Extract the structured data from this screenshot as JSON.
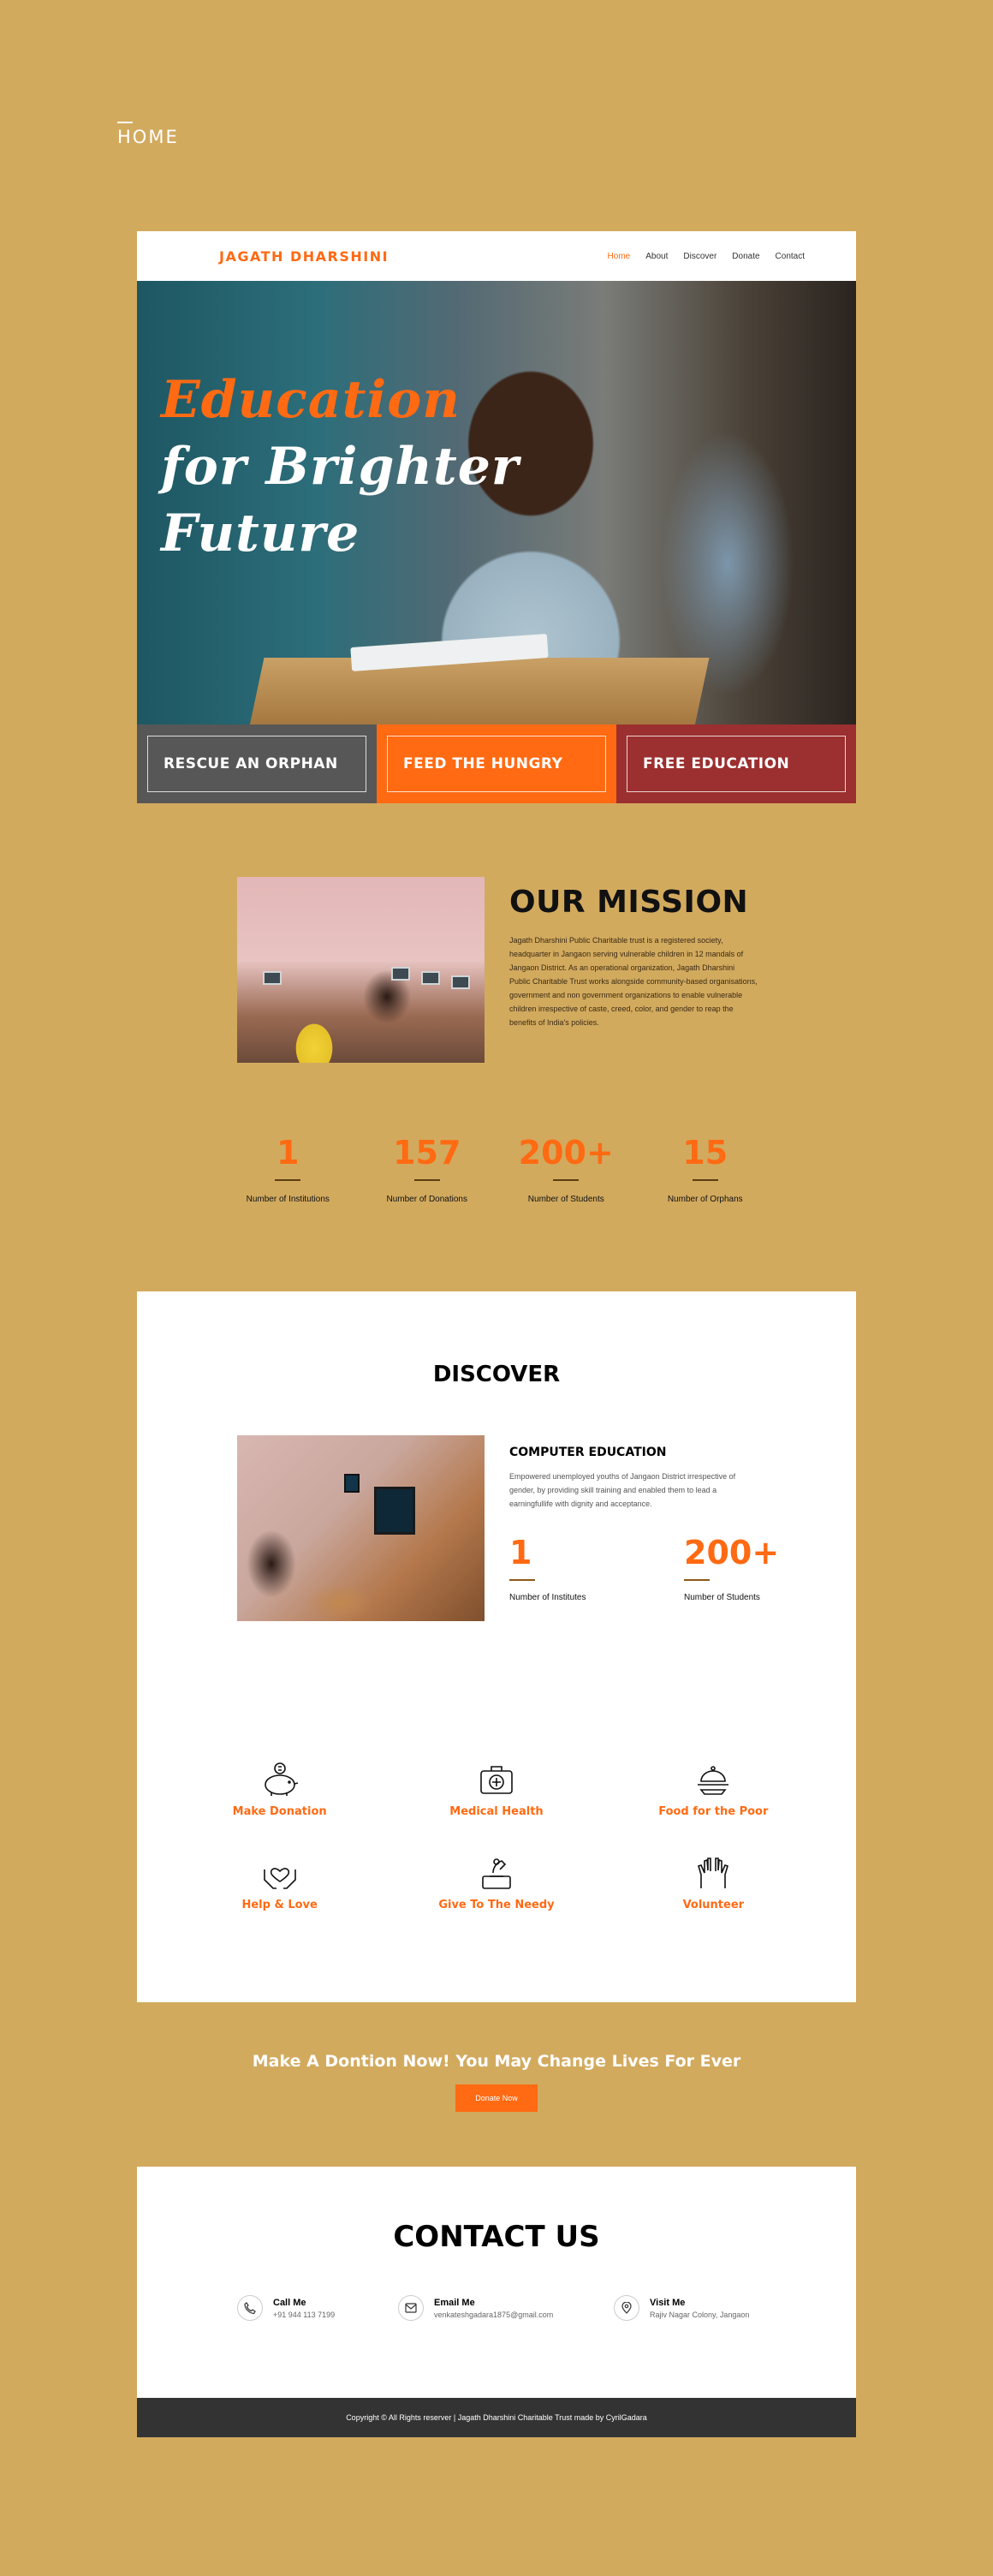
{
  "page_label": "HOME",
  "nav": {
    "logo": "JAGATH DHARSHINI",
    "items": [
      {
        "label": "Home",
        "active": true
      },
      {
        "label": "About",
        "active": false
      },
      {
        "label": "Discover",
        "active": false
      },
      {
        "label": "Donate",
        "active": false
      },
      {
        "label": "Contact",
        "active": false
      }
    ]
  },
  "hero": {
    "line1": "Education",
    "line2": "for Brighter",
    "line3": "Future"
  },
  "tiles": [
    {
      "label": "RESCUE AN ORPHAN"
    },
    {
      "label": "FEED THE HUNGRY"
    },
    {
      "label": "FREE EDUCATION"
    }
  ],
  "mission": {
    "title": "OUR MISSION",
    "text": "Jagath Dharshini Public Charitable trust is a registered society, headquarter in Jangaon serving vulnerable children in 12 mandals of Jangaon District. As an operational organization, Jagath Dharshini Public Charitable Trust works alongside community-based organisations, government and non government organizations to enable vulnerable children irrespective of caste, creed, color, and gender to reap the benefits of India's policies.",
    "stats": [
      {
        "value": "1",
        "label": "Number of Institutions"
      },
      {
        "value": "157",
        "label": "Number of Donations"
      },
      {
        "value": "200+",
        "label": "Number of Students"
      },
      {
        "value": "15",
        "label": "Number of Orphans"
      }
    ]
  },
  "discover": {
    "title": "DISCOVER",
    "subtitle": "COMPUTER EDUCATION",
    "text": "Empowered unemployed youths of Jangaon District irrespective of gender, by providing skill training and enabled them to lead a earningfullife with dignity and acceptance.",
    "stats": [
      {
        "value": "1",
        "label": "Number of Institutes"
      },
      {
        "value": "200+",
        "label": "Number of Students"
      }
    ],
    "features": [
      {
        "label": "Make Donation",
        "icon": "piggy-bank-icon"
      },
      {
        "label": "Medical Health",
        "icon": "medical-kit-icon"
      },
      {
        "label": "Food for the Poor",
        "icon": "food-cloche-icon"
      },
      {
        "label": "Help & Love",
        "icon": "heart-hands-icon"
      },
      {
        "label": "Give To The Needy",
        "icon": "donation-box-icon"
      },
      {
        "label": "Volunteer",
        "icon": "raised-hands-icon"
      }
    ]
  },
  "donate": {
    "message": "Make A Dontion Now! You May Change Lives For Ever",
    "button": "Donate Now"
  },
  "contact": {
    "title": "CONTACT US",
    "items": [
      {
        "title": "Call Me",
        "value": "+91 944 113 7199",
        "icon": "phone-icon"
      },
      {
        "title": "Email Me",
        "value": "venkateshgadara1875@gmail.com",
        "icon": "mail-icon"
      },
      {
        "title": "Visit Me",
        "value": "Rajiv Nagar Colony, Jangaon",
        "icon": "location-pin-icon"
      }
    ]
  },
  "footer": {
    "text": "Copyright © All Rights reserver | Jagath Dharshini Charitable Trust made by CyrilGadara"
  },
  "colors": {
    "background": "#d2aa5e",
    "accent": "#ff6a13",
    "tile_grey": "#575757",
    "tile_red": "#9c2f2f",
    "footer": "#333333"
  }
}
